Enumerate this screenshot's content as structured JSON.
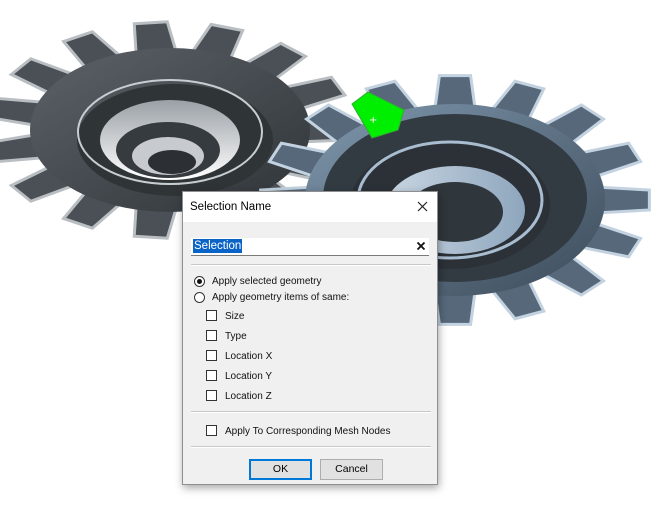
{
  "dialog": {
    "title": "Selection Name",
    "name_value": "Selection",
    "radio_apply_selected": "Apply selected geometry",
    "radio_apply_same": "Apply geometry items of same:",
    "options": [
      "Size",
      "Type",
      "Location X",
      "Location Y",
      "Location Z"
    ],
    "mesh_nodes": "Apply To Corresponding Mesh Nodes",
    "ok": "OK",
    "cancel": "Cancel",
    "selected_radio": "apply-selected"
  },
  "viewport": {
    "highlight_color": "#00ee00",
    "gear_left_color": "#3d4247",
    "gear_right_color": "#9bb3c9"
  }
}
